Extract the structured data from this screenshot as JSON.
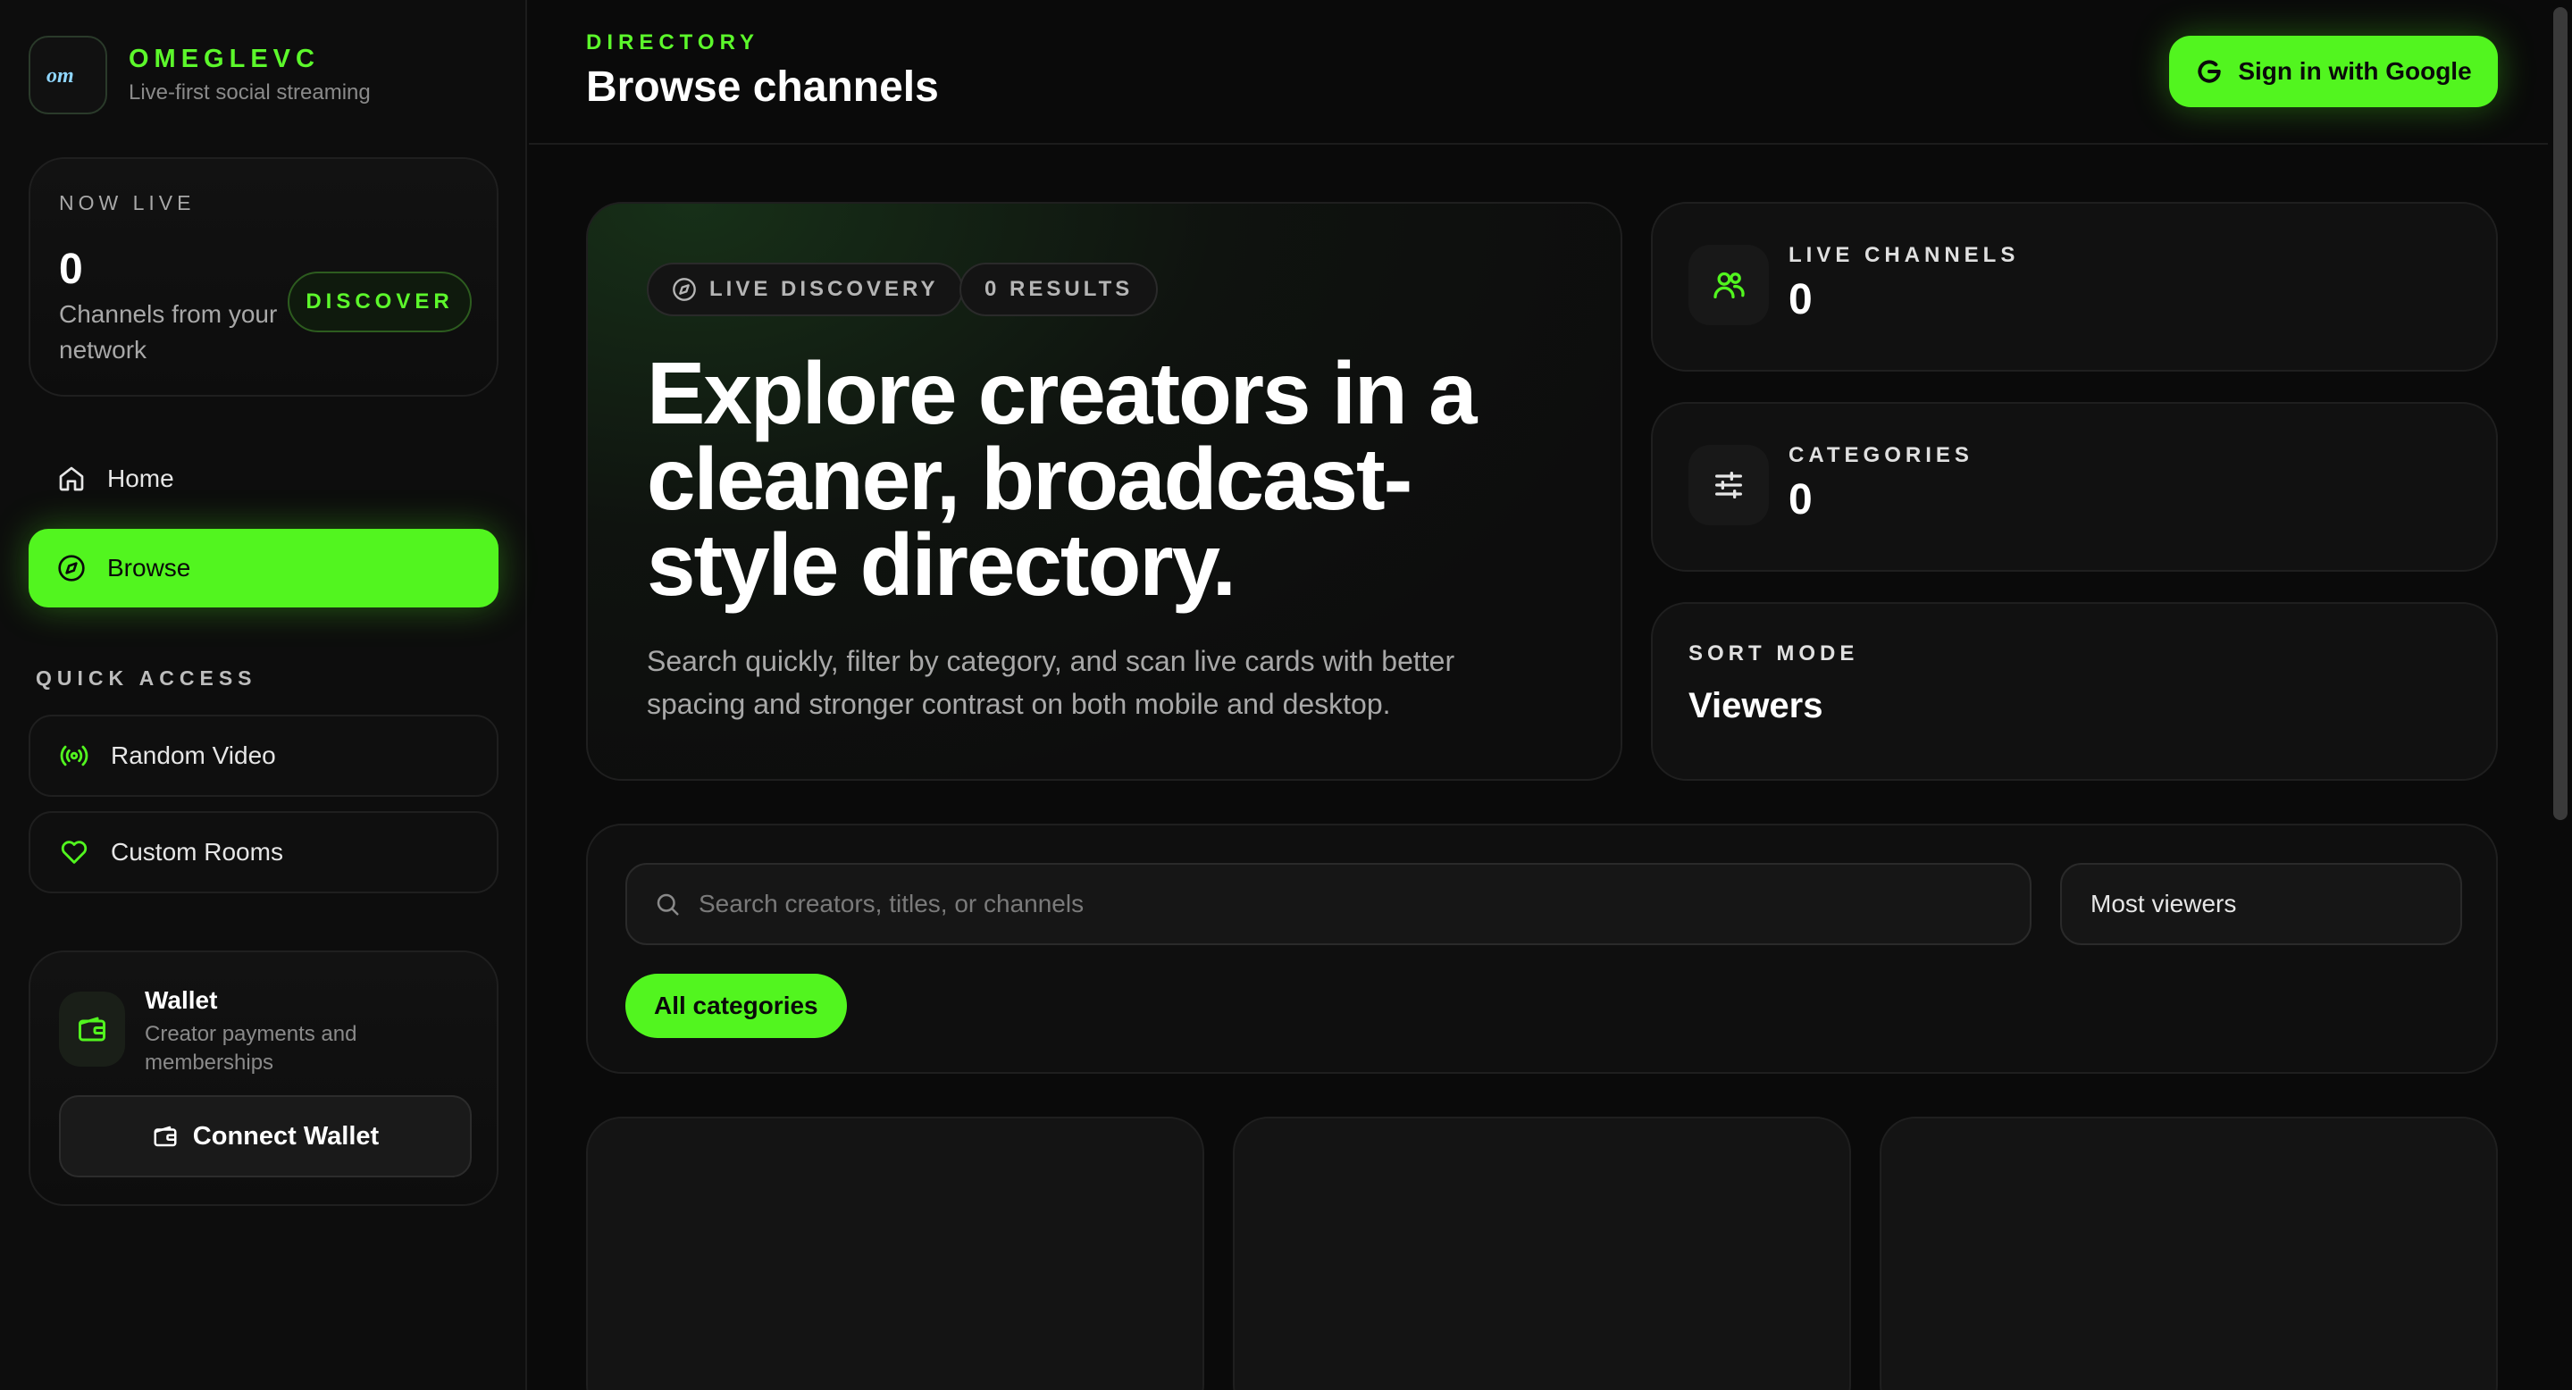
{
  "brand": {
    "name": "OMEGLEVC",
    "tagline": "Live-first social streaming",
    "logo_text": "om"
  },
  "now_live": {
    "label": "NOW LIVE",
    "count": "0",
    "description": "Channels from your network",
    "discover_label": "DISCOVER"
  },
  "nav": {
    "home": "Home",
    "browse": "Browse"
  },
  "quick_access": {
    "label": "QUICK ACCESS",
    "items": [
      "Random Video",
      "Custom Rooms"
    ]
  },
  "wallet": {
    "title": "Wallet",
    "description": "Creator payments and memberships",
    "connect_label": "Connect Wallet"
  },
  "header": {
    "section": "DIRECTORY",
    "title": "Browse channels",
    "signin_label": "Sign in with Google"
  },
  "hero": {
    "pill_discovery": "LIVE DISCOVERY",
    "pill_results": "0 RESULTS",
    "title": "Explore creators in a cleaner, broadcast-style directory.",
    "description": "Search quickly, filter by category, and scan live cards with better spacing and stronger contrast on both mobile and desktop."
  },
  "stats": {
    "live_channels": {
      "label": "LIVE CHANNELS",
      "value": "0"
    },
    "categories": {
      "label": "CATEGORIES",
      "value": "0"
    },
    "sort_mode": {
      "label": "SORT MODE",
      "value": "Viewers"
    }
  },
  "filter": {
    "search_placeholder": "Search creators, titles, or channels",
    "search_value": "",
    "sort_selected": "Most viewers",
    "category_chip": "All categories"
  },
  "colors": {
    "accent": "#52f51f",
    "background": "#0a0a0a",
    "card": "#111111"
  },
  "icons": {
    "home": "home-icon",
    "browse": "compass-icon",
    "random": "broadcast-icon",
    "rooms": "heart-icon",
    "wallet": "wallet-icon",
    "google": "google-icon",
    "users": "users-icon",
    "categories": "sliders-icon",
    "search": "search-icon"
  }
}
